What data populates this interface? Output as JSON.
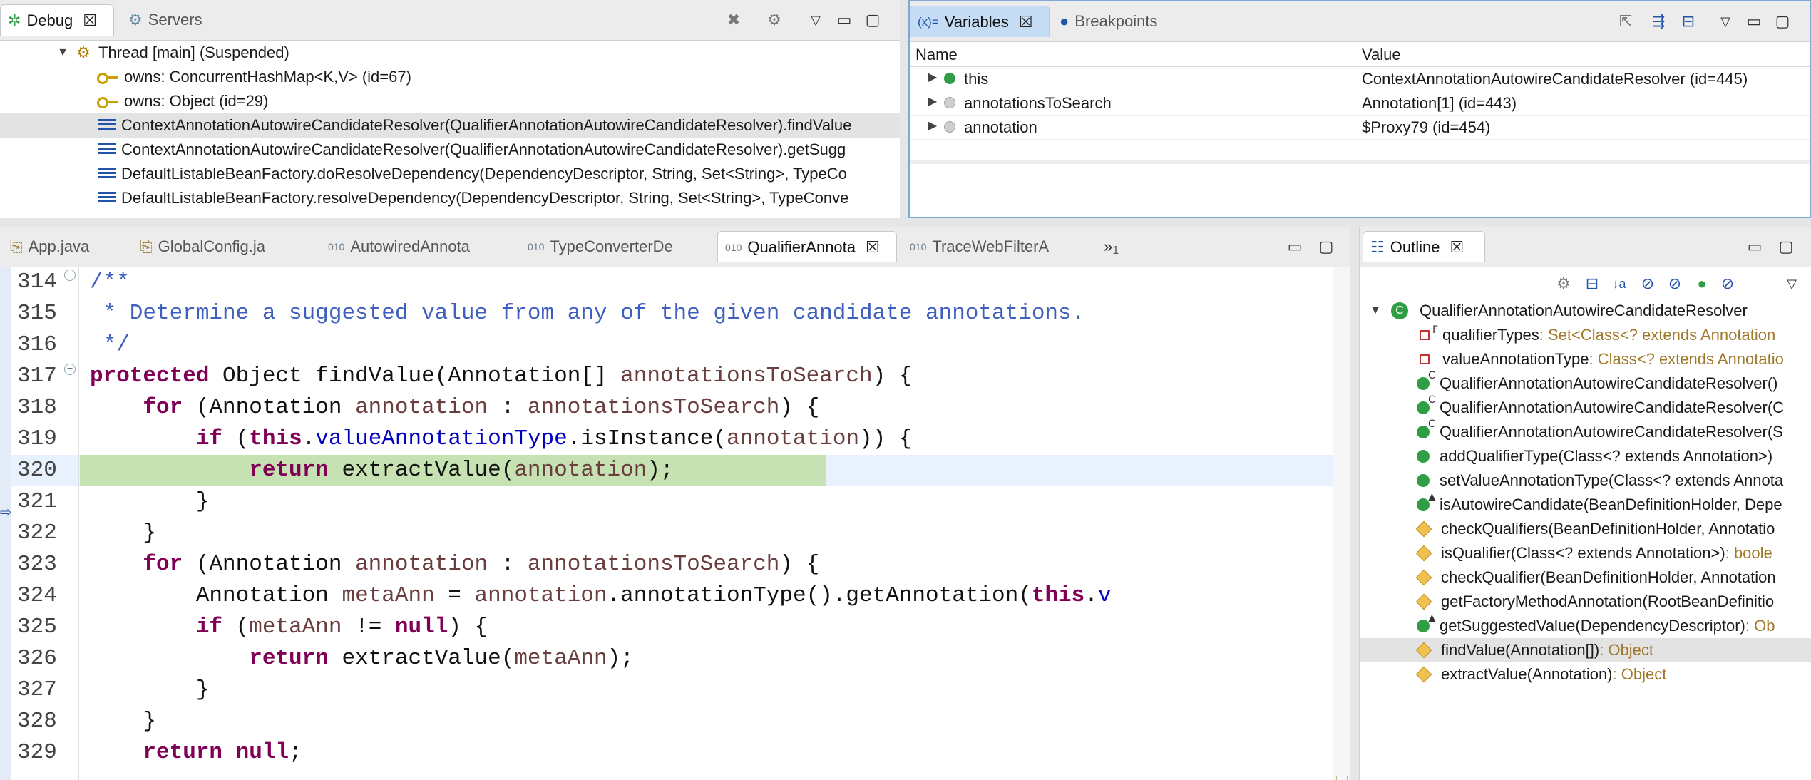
{
  "debug_view": {
    "tabs": [
      {
        "label": "Debug",
        "active": true
      },
      {
        "label": "Servers",
        "active": false
      }
    ],
    "thread": "Thread [main] (Suspended)",
    "items": [
      {
        "kind": "monitor",
        "label": "owns: ConcurrentHashMap<K,V>  (id=67)"
      },
      {
        "kind": "monitor",
        "label": "owns: Object  (id=29)"
      },
      {
        "kind": "frame",
        "label": "ContextAnnotationAutowireCandidateResolver(QualifierAnnotationAutowireCandidateResolver).findValue",
        "selected": true
      },
      {
        "kind": "frame",
        "label": "ContextAnnotationAutowireCandidateResolver(QualifierAnnotationAutowireCandidateResolver).getSugg"
      },
      {
        "kind": "frame",
        "label": "DefaultListableBeanFactory.doResolveDependency(DependencyDescriptor, String, Set<String>, TypeCo"
      },
      {
        "kind": "frame",
        "label": "DefaultListableBeanFactory.resolveDependency(DependencyDescriptor, String, Set<String>, TypeConve"
      }
    ]
  },
  "variables_view": {
    "tabs": [
      {
        "label": "Variables",
        "prefix": "(x)=",
        "active": true
      },
      {
        "label": "Breakpoints",
        "active": false
      }
    ],
    "columns": [
      "Name",
      "Value"
    ],
    "rows": [
      {
        "name": "this",
        "value": "ContextAnnotationAutowireCandidateResolver  (id=445)",
        "icon": "green"
      },
      {
        "name": "annotationsToSearch",
        "value": "Annotation[1]  (id=443)",
        "icon": "gray"
      },
      {
        "name": "annotation",
        "value": "$Proxy79  (id=454)",
        "icon": "gray"
      }
    ]
  },
  "editor": {
    "tabs": [
      {
        "label": "App.java",
        "active": false
      },
      {
        "label": "GlobalConfig.ja",
        "active": false
      },
      {
        "label": "AutowiredAnnota",
        "active": false
      },
      {
        "label": "TypeConverterDe",
        "active": false
      },
      {
        "label": "QualifierAnnota",
        "active": true
      },
      {
        "label": "TraceWebFilterA",
        "active": false
      }
    ],
    "overflow_label": "»",
    "overflow_count": "1",
    "current_line": "320",
    "lines": [
      {
        "n": "314",
        "tokens": [
          {
            "t": "/**",
            "c": "cmt"
          }
        ]
      },
      {
        "n": "315",
        "tokens": [
          {
            "t": " * Determine a suggested value from any of the given candidate annotations.",
            "c": "cmt"
          }
        ]
      },
      {
        "n": "316",
        "tokens": [
          {
            "t": " */",
            "c": "cmt"
          }
        ]
      },
      {
        "n": "317",
        "tokens": [
          {
            "t": "protected",
            "c": "kw"
          },
          {
            "t": " Object findValue(Annotation[] ",
            "c": ""
          },
          {
            "t": "annotationsToSearch",
            "c": "param"
          },
          {
            "t": ") {",
            "c": ""
          }
        ]
      },
      {
        "n": "318",
        "tokens": [
          {
            "t": "    ",
            "c": ""
          },
          {
            "t": "for",
            "c": "kw"
          },
          {
            "t": " (Annotation ",
            "c": ""
          },
          {
            "t": "annotation",
            "c": "param"
          },
          {
            "t": " : ",
            "c": ""
          },
          {
            "t": "annotationsToSearch",
            "c": "param"
          },
          {
            "t": ") {",
            "c": ""
          }
        ]
      },
      {
        "n": "319",
        "tokens": [
          {
            "t": "        ",
            "c": ""
          },
          {
            "t": "if",
            "c": "kw"
          },
          {
            "t": " (",
            "c": ""
          },
          {
            "t": "this",
            "c": "kw"
          },
          {
            "t": ".",
            "c": ""
          },
          {
            "t": "valueAnnotationType",
            "c": "field"
          },
          {
            "t": ".isInstance(",
            "c": ""
          },
          {
            "t": "annotation",
            "c": "param"
          },
          {
            "t": ")) {",
            "c": ""
          }
        ]
      },
      {
        "n": "320",
        "tokens": [
          {
            "t": "            ",
            "c": ""
          },
          {
            "t": "return",
            "c": "kw"
          },
          {
            "t": " extractValue(",
            "c": ""
          },
          {
            "t": "annotation",
            "c": "param"
          },
          {
            "t": ");",
            "c": ""
          }
        ]
      },
      {
        "n": "321",
        "tokens": [
          {
            "t": "        }",
            "c": ""
          }
        ]
      },
      {
        "n": "322",
        "tokens": [
          {
            "t": "    }",
            "c": ""
          }
        ]
      },
      {
        "n": "323",
        "tokens": [
          {
            "t": "    ",
            "c": ""
          },
          {
            "t": "for",
            "c": "kw"
          },
          {
            "t": " (Annotation ",
            "c": ""
          },
          {
            "t": "annotation",
            "c": "param"
          },
          {
            "t": " : ",
            "c": ""
          },
          {
            "t": "annotationsToSearch",
            "c": "param"
          },
          {
            "t": ") {",
            "c": ""
          }
        ]
      },
      {
        "n": "324",
        "tokens": [
          {
            "t": "        Annotation ",
            "c": ""
          },
          {
            "t": "metaAnn",
            "c": "param"
          },
          {
            "t": " = ",
            "c": ""
          },
          {
            "t": "annotation",
            "c": "param"
          },
          {
            "t": ".annotationType().getAnnotation(",
            "c": ""
          },
          {
            "t": "this",
            "c": "kw"
          },
          {
            "t": ".",
            "c": ""
          },
          {
            "t": "v",
            "c": "field"
          }
        ]
      },
      {
        "n": "325",
        "tokens": [
          {
            "t": "        ",
            "c": ""
          },
          {
            "t": "if",
            "c": "kw"
          },
          {
            "t": " (",
            "c": ""
          },
          {
            "t": "metaAnn",
            "c": "param"
          },
          {
            "t": " != ",
            "c": ""
          },
          {
            "t": "null",
            "c": "kw"
          },
          {
            "t": ") {",
            "c": ""
          }
        ]
      },
      {
        "n": "326",
        "tokens": [
          {
            "t": "            ",
            "c": ""
          },
          {
            "t": "return",
            "c": "kw"
          },
          {
            "t": " extractValue(",
            "c": ""
          },
          {
            "t": "metaAnn",
            "c": "param"
          },
          {
            "t": ");",
            "c": ""
          }
        ]
      },
      {
        "n": "327",
        "tokens": [
          {
            "t": "        }",
            "c": ""
          }
        ]
      },
      {
        "n": "328",
        "tokens": [
          {
            "t": "    }",
            "c": ""
          }
        ]
      },
      {
        "n": "329",
        "tokens": [
          {
            "t": "    ",
            "c": ""
          },
          {
            "t": "return",
            "c": "kw"
          },
          {
            "t": " ",
            "c": ""
          },
          {
            "t": "null",
            "c": "kw"
          },
          {
            "t": ";",
            "c": ""
          }
        ]
      }
    ]
  },
  "outline_view": {
    "tab": "Outline",
    "class_name": "QualifierAnnotationAutowireCandidateResolver",
    "members": [
      {
        "name": "qualifierTypes",
        "type": " : Set<Class<? extends Annotation",
        "icon": "private-field",
        "sup": "F"
      },
      {
        "name": "valueAnnotationType",
        "type": " : Class<? extends Annotatio",
        "icon": "private-field",
        "sup": ""
      },
      {
        "name": "QualifierAnnotationAutowireCandidateResolver()",
        "type": "",
        "icon": "public",
        "sup": "C"
      },
      {
        "name": "QualifierAnnotationAutowireCandidateResolver(C",
        "type": "",
        "icon": "public",
        "sup": "C"
      },
      {
        "name": "QualifierAnnotationAutowireCandidateResolver(S",
        "type": "",
        "icon": "public",
        "sup": "C"
      },
      {
        "name": "addQualifierType(Class<? extends Annotation>)",
        "type": "",
        "icon": "public",
        "sup": ""
      },
      {
        "name": "setValueAnnotationType(Class<? extends Annota",
        "type": "",
        "icon": "public",
        "sup": ""
      },
      {
        "name": "isAutowireCandidate(BeanDefinitionHolder, Depe",
        "type": "",
        "icon": "public",
        "sup": "▲"
      },
      {
        "name": "checkQualifiers(BeanDefinitionHolder, Annotatio",
        "type": "",
        "icon": "protected",
        "sup": ""
      },
      {
        "name": "isQualifier(Class<? extends Annotation>)",
        "type": " : boole",
        "icon": "protected",
        "sup": ""
      },
      {
        "name": "checkQualifier(BeanDefinitionHolder, Annotation",
        "type": "",
        "icon": "protected",
        "sup": ""
      },
      {
        "name": "getFactoryMethodAnnotation(RootBeanDefinitio",
        "type": "",
        "icon": "protected",
        "sup": ""
      },
      {
        "name": "getSuggestedValue(DependencyDescriptor)",
        "type": " : Ob",
        "icon": "public",
        "sup": "▲"
      },
      {
        "name": "findValue(Annotation[])",
        "type": " : Object",
        "icon": "protected",
        "sup": "",
        "selected": true
      },
      {
        "name": "extractValue(Annotation)",
        "type": " : Object",
        "icon": "protected",
        "sup": ""
      }
    ]
  }
}
